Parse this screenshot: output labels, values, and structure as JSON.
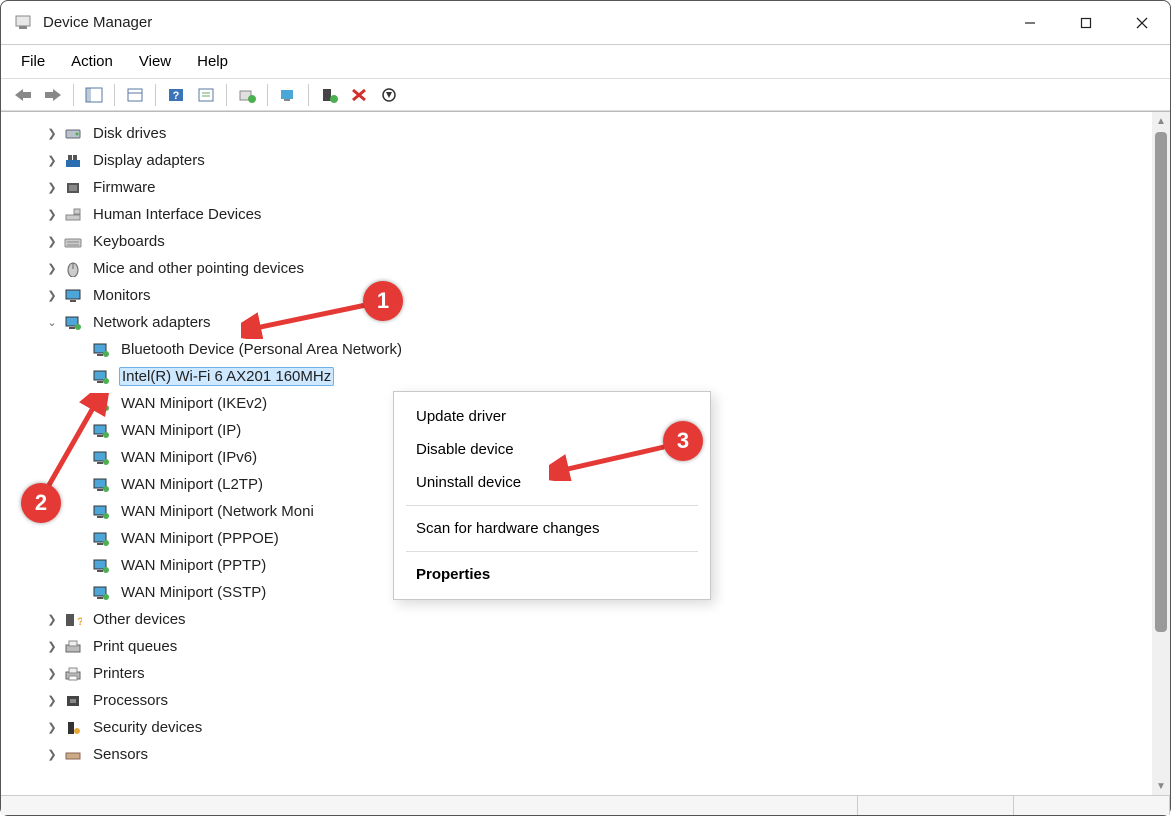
{
  "window": {
    "title": "Device Manager"
  },
  "menus": {
    "file": "File",
    "action": "Action",
    "view": "View",
    "help": "Help"
  },
  "tree": [
    {
      "level": 1,
      "arrow": "right",
      "icon": "disk",
      "label": "Disk drives"
    },
    {
      "level": 1,
      "arrow": "right",
      "icon": "display",
      "label": "Display adapters"
    },
    {
      "level": 1,
      "arrow": "right",
      "icon": "chip",
      "label": "Firmware"
    },
    {
      "level": 1,
      "arrow": "right",
      "icon": "hid",
      "label": "Human Interface Devices"
    },
    {
      "level": 1,
      "arrow": "right",
      "icon": "keyboard",
      "label": "Keyboards"
    },
    {
      "level": 1,
      "arrow": "right",
      "icon": "mouse",
      "label": "Mice and other pointing devices"
    },
    {
      "level": 1,
      "arrow": "right",
      "icon": "monitor",
      "label": "Monitors"
    },
    {
      "level": 1,
      "arrow": "down",
      "icon": "net",
      "label": "Network adapters"
    },
    {
      "level": 2,
      "arrow": "",
      "icon": "net",
      "label": "Bluetooth Device (Personal Area Network)"
    },
    {
      "level": 2,
      "arrow": "",
      "icon": "net",
      "label": "Intel(R) Wi-Fi 6 AX201 160MHz",
      "selected": true
    },
    {
      "level": 2,
      "arrow": "",
      "icon": "net",
      "label": "WAN Miniport (IKEv2)"
    },
    {
      "level": 2,
      "arrow": "",
      "icon": "net",
      "label": "WAN Miniport (IP)"
    },
    {
      "level": 2,
      "arrow": "",
      "icon": "net",
      "label": "WAN Miniport (IPv6)"
    },
    {
      "level": 2,
      "arrow": "",
      "icon": "net",
      "label": "WAN Miniport (L2TP)"
    },
    {
      "level": 2,
      "arrow": "",
      "icon": "net",
      "label": "WAN Miniport (Network Moni"
    },
    {
      "level": 2,
      "arrow": "",
      "icon": "net",
      "label": "WAN Miniport (PPPOE)"
    },
    {
      "level": 2,
      "arrow": "",
      "icon": "net",
      "label": "WAN Miniport (PPTP)"
    },
    {
      "level": 2,
      "arrow": "",
      "icon": "net",
      "label": "WAN Miniport (SSTP)"
    },
    {
      "level": 1,
      "arrow": "right",
      "icon": "other",
      "label": "Other devices"
    },
    {
      "level": 1,
      "arrow": "right",
      "icon": "printqueue",
      "label": "Print queues"
    },
    {
      "level": 1,
      "arrow": "right",
      "icon": "printer",
      "label": "Printers"
    },
    {
      "level": 1,
      "arrow": "right",
      "icon": "cpu",
      "label": "Processors"
    },
    {
      "level": 1,
      "arrow": "right",
      "icon": "security",
      "label": "Security devices"
    },
    {
      "level": 1,
      "arrow": "right",
      "icon": "sensor",
      "label": "Sensors"
    }
  ],
  "context_menu": {
    "update": "Update driver",
    "disable": "Disable device",
    "uninstall": "Uninstall device",
    "scan": "Scan for hardware changes",
    "properties": "Properties"
  },
  "annotations": {
    "b1": "1",
    "b2": "2",
    "b3": "3"
  }
}
